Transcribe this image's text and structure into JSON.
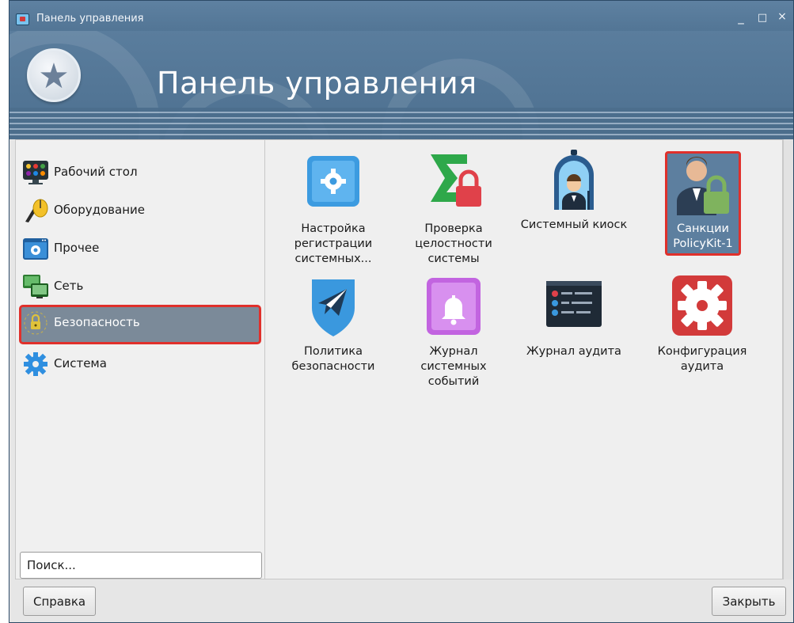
{
  "window": {
    "title": "Панель управления",
    "controls": {
      "minimize": "_",
      "maximize": "□",
      "close": "×"
    }
  },
  "banner": {
    "title": "Панель управления",
    "icon": "star-badge-icon"
  },
  "sidebar": {
    "items": [
      {
        "label": "Рабочий стол",
        "icon": "desktop-icon",
        "selected": false
      },
      {
        "label": "Оборудование",
        "icon": "hardware-icon",
        "selected": false
      },
      {
        "label": "Прочее",
        "icon": "misc-icon",
        "selected": false
      },
      {
        "label": "Сеть",
        "icon": "network-icon",
        "selected": false
      },
      {
        "label": "Безопасность",
        "icon": "security-icon",
        "selected": true
      },
      {
        "label": "Система",
        "icon": "system-gear-icon",
        "selected": false
      }
    ],
    "search_placeholder": "Поиск..."
  },
  "content": {
    "tiles": [
      {
        "label_lines": [
          "Настройка",
          "регистрации",
          "системных..."
        ],
        "icon": "registration-settings-icon"
      },
      {
        "label_lines": [
          "Проверка",
          "целостности",
          "системы"
        ],
        "icon": "integrity-check-icon"
      },
      {
        "label_lines": [
          "Системный киоск"
        ],
        "icon": "system-kiosk-icon"
      },
      {
        "label_lines": [
          "Санкции",
          "PolicyKit-1"
        ],
        "icon": "policykit-icon",
        "highlighted": true
      },
      {
        "label_lines": [
          "Политика",
          "безопасности"
        ],
        "icon": "security-policy-icon"
      },
      {
        "label_lines": [
          "Журнал",
          "системных",
          "событий"
        ],
        "icon": "system-events-log-icon"
      },
      {
        "label_lines": [
          "Журнал аудита"
        ],
        "icon": "audit-log-icon"
      },
      {
        "label_lines": [
          "Конфигурация",
          "аудита"
        ],
        "icon": "audit-config-icon"
      }
    ]
  },
  "footer": {
    "help_label": "Справка",
    "close_label": "Закрыть"
  },
  "colors": {
    "titlebar": "#5e81a1",
    "selection": "#7b8a99",
    "highlight_border": "#e0302b"
  }
}
